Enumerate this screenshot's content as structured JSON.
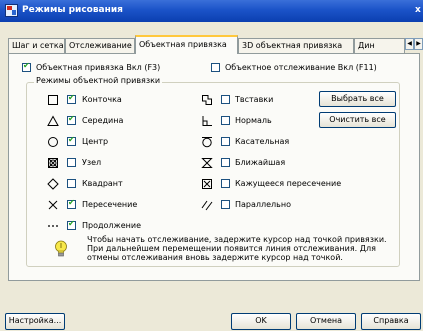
{
  "window": {
    "title": "Режимы рисования",
    "close_glyph": "x"
  },
  "tabs": [
    {
      "label": "Шаг и сетка",
      "active": false
    },
    {
      "label": "Отслеживание",
      "active": false
    },
    {
      "label": "Объектная привязка",
      "active": true
    },
    {
      "label": "3D объектная привязка",
      "active": false
    },
    {
      "label": "Дин",
      "active": false
    }
  ],
  "tab_scroll": {
    "left": "◀",
    "right": "▶"
  },
  "top_options": {
    "osnap_on": {
      "label": "Объектная привязка Вкл (F3)",
      "checked": true
    },
    "otrack_on": {
      "label": "Объектное отслеживание Вкл (F11)",
      "checked": false
    }
  },
  "modes_group": {
    "legend": "Режимы объектной привязки",
    "left": [
      {
        "icon": "square-icon",
        "label": "Конточка",
        "checked": true
      },
      {
        "icon": "triangle-icon",
        "label": "Середина",
        "checked": true
      },
      {
        "icon": "circle-icon",
        "label": "Центр",
        "checked": true
      },
      {
        "icon": "node-icon",
        "label": "Узел",
        "checked": false
      },
      {
        "icon": "diamond-icon",
        "label": "Квадрант",
        "checked": false
      },
      {
        "icon": "x-mark-icon",
        "label": "Пересечение",
        "checked": true
      },
      {
        "icon": "extension-icon",
        "label": "Продолжение",
        "checked": true
      }
    ],
    "right": [
      {
        "icon": "insertion-icon",
        "label": "Твставки",
        "checked": false
      },
      {
        "icon": "perpendicular-icon",
        "label": "Нормаль",
        "checked": false
      },
      {
        "icon": "tangent-icon",
        "label": "Касательная",
        "checked": false
      },
      {
        "icon": "nearest-icon",
        "label": "Ближайшая",
        "checked": false
      },
      {
        "icon": "apparent-intersection-icon",
        "label": "Кажущееся пересечение",
        "checked": false
      },
      {
        "icon": "parallel-icon",
        "label": "Параллельно",
        "checked": false
      }
    ],
    "select_all": "Выбрать все",
    "clear_all": "Очистить все"
  },
  "hint": {
    "lines": [
      "Чтобы начать отслеживание, задержите курсор над точкой привязки.",
      "При дальнейшем перемещении появится линия отслеживания. Для",
      "отмены отслеживания вновь задержите курсор над точкой."
    ]
  },
  "footer": {
    "settings": "Настройка...",
    "ok": "OK",
    "cancel": "Отмена",
    "help": "Справка"
  }
}
